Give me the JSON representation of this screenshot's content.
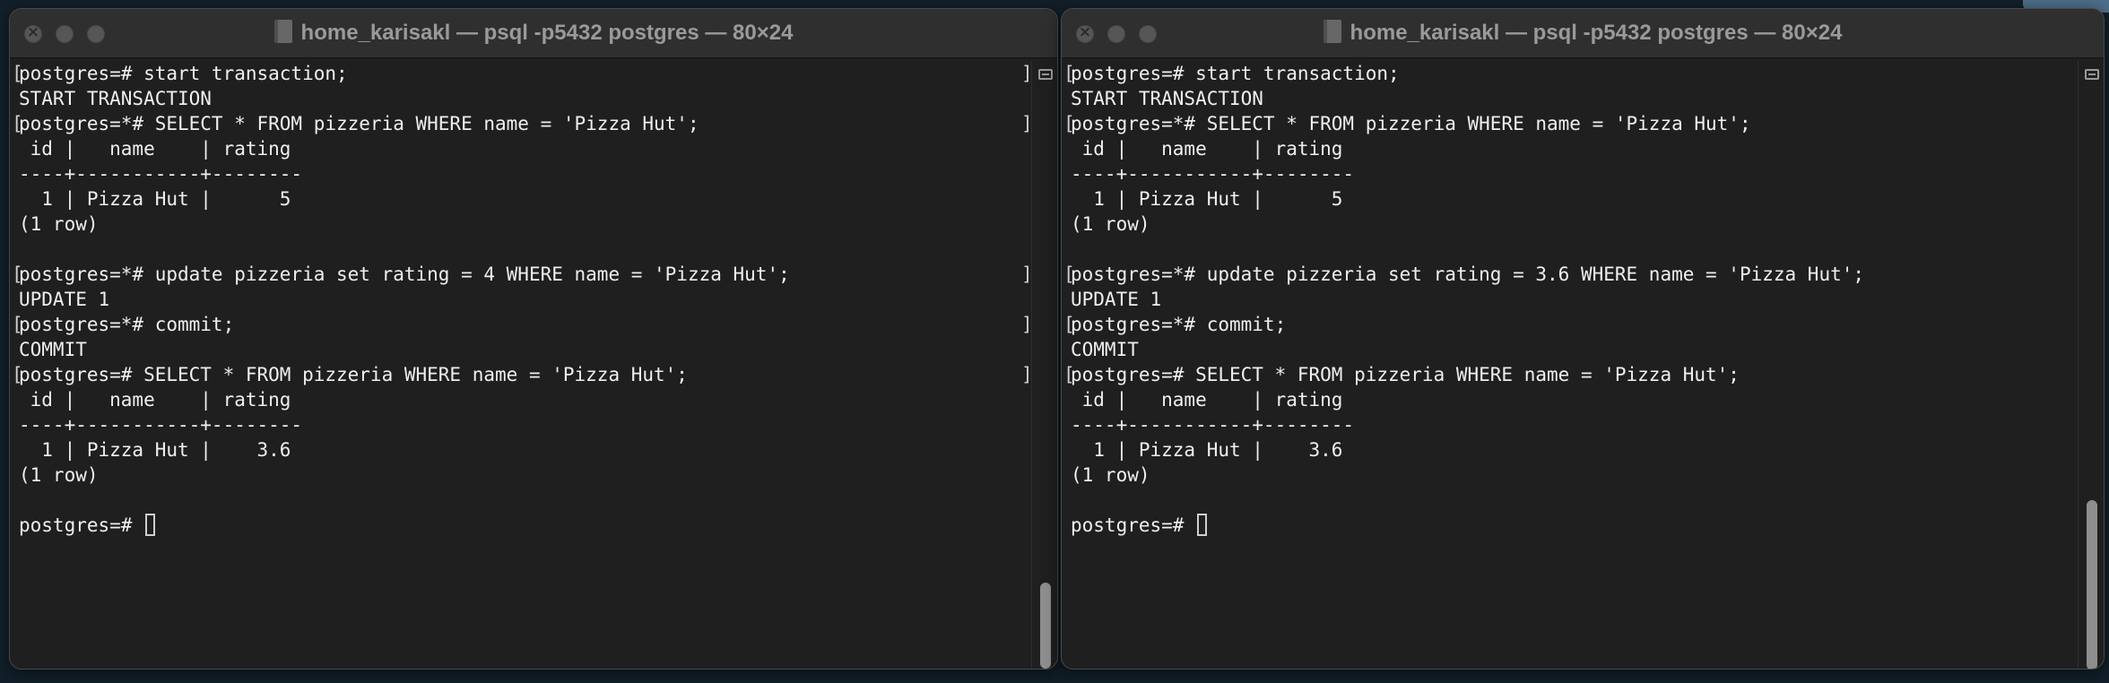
{
  "windows": [
    {
      "title": "home_karisakl — psql -p5432 postgres — 80×24",
      "lines": [
        {
          "text": "postgres=# start transaction;",
          "brackets": true
        },
        {
          "text": "START TRANSACTION",
          "brackets": false
        },
        {
          "text": "postgres=*# SELECT * FROM pizzeria WHERE name = 'Pizza Hut';",
          "brackets": true
        },
        {
          "text": " id |   name    | rating",
          "brackets": false
        },
        {
          "text": "----+-----------+--------",
          "brackets": false
        },
        {
          "text": "  1 | Pizza Hut |      5",
          "brackets": false
        },
        {
          "text": "(1 row)",
          "brackets": false
        },
        {
          "text": "",
          "brackets": false
        },
        {
          "text": "postgres=*# update pizzeria set rating = 4 WHERE name = 'Pizza Hut';",
          "brackets": true
        },
        {
          "text": "UPDATE 1",
          "brackets": false
        },
        {
          "text": "postgres=*# commit;",
          "brackets": true
        },
        {
          "text": "COMMIT",
          "brackets": false
        },
        {
          "text": "postgres=# SELECT * FROM pizzeria WHERE name = 'Pizza Hut';",
          "brackets": true
        },
        {
          "text": " id |   name    | rating",
          "brackets": false
        },
        {
          "text": "----+-----------+--------",
          "brackets": false
        },
        {
          "text": "  1 | Pizza Hut |    3.6",
          "brackets": false
        },
        {
          "text": "(1 row)",
          "brackets": false
        },
        {
          "text": "",
          "brackets": false
        },
        {
          "text": "postgres=# ",
          "brackets": false,
          "cursor": true
        }
      ]
    },
    {
      "title": "home_karisakl — psql -p5432 postgres — 80×24",
      "lines": [
        {
          "text": "postgres=# start transaction;",
          "brackets": true
        },
        {
          "text": "START TRANSACTION",
          "brackets": false
        },
        {
          "text": "postgres=*# SELECT * FROM pizzeria WHERE name = 'Pizza Hut';",
          "brackets": true
        },
        {
          "text": " id |   name    | rating",
          "brackets": false
        },
        {
          "text": "----+-----------+--------",
          "brackets": false
        },
        {
          "text": "  1 | Pizza Hut |      5",
          "brackets": false
        },
        {
          "text": "(1 row)",
          "brackets": false
        },
        {
          "text": "",
          "brackets": false
        },
        {
          "text": "postgres=*# update pizzeria set rating = 3.6 WHERE name = 'Pizza Hut';",
          "brackets": true
        },
        {
          "text": "UPDATE 1",
          "brackets": false
        },
        {
          "text": "postgres=*# commit;",
          "brackets": true
        },
        {
          "text": "COMMIT",
          "brackets": false
        },
        {
          "text": "postgres=# SELECT * FROM pizzeria WHERE name = 'Pizza Hut';",
          "brackets": true
        },
        {
          "text": " id |   name    | rating",
          "brackets": false
        },
        {
          "text": "----+-----------+--------",
          "brackets": false
        },
        {
          "text": "  1 | Pizza Hut |    3.6",
          "brackets": false
        },
        {
          "text": "(1 row)",
          "brackets": false
        },
        {
          "text": "",
          "brackets": false
        },
        {
          "text": "postgres=# ",
          "brackets": false,
          "cursor": true
        }
      ]
    }
  ]
}
